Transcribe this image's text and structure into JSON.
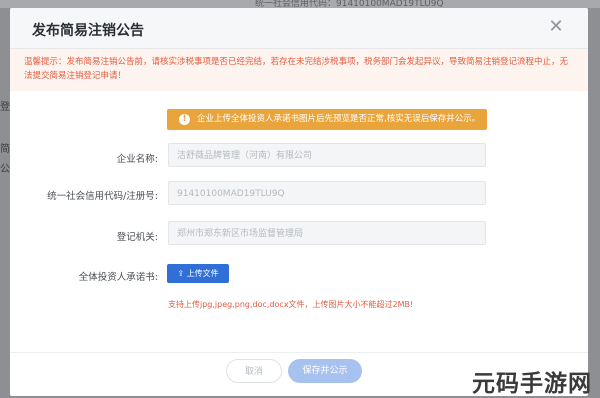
{
  "background": {
    "top_text": "统一社会信用代码：91410100MAD19TLU9Q",
    "left_chars": [
      "名",
      "登",
      "简",
      "公"
    ]
  },
  "dialog": {
    "title": "发布简易注销公告",
    "close_symbol": "✕",
    "notice": "温馨提示：发布简易注销公告前，请核实涉税事项是否已经完结，若存在未完结涉税事项，税务部门会发起异议，导致简易注销登记流程中止，无法提交简易注销登记申请！",
    "warning": "企业上传全体投资人承诺书图片后先预览是否正常,核实无误后保存并公示。",
    "fields": {
      "company_name_label": "企业名称:",
      "company_name_value": "洁舒薇品牌管理（河南）有限公司",
      "credit_code_label": "统一社会信用代码/注册号:",
      "credit_code_value": "91410100MAD19TLU9Q",
      "authority_label": "登记机关:",
      "authority_value": "郑州市郑东新区市场监督管理局",
      "commitment_label": "全体投资人承诺书:"
    },
    "upload_button": "上传文件",
    "upload_hint": "支持上传jpg,jpeg,png,doc,docx文件，上传图片大小不能超过2MB!",
    "cancel_button": "取消",
    "save_button": "保存并公示"
  },
  "watermark": "元码手游网",
  "colors": {
    "primary": "#2f6fd7",
    "warning": "#e9a53b",
    "error_text": "#e55b3f",
    "save_disabled": "#a8c2ef"
  }
}
